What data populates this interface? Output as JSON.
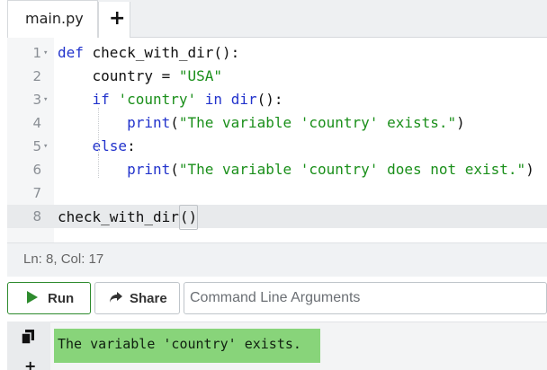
{
  "tabs": [
    {
      "label": "main.py"
    }
  ],
  "add_tab_symbol": "+",
  "editor": {
    "lines": [
      {
        "num": "1",
        "fold": true,
        "parts": [
          {
            "t": "kw",
            "v": "def"
          },
          {
            "t": "plain",
            "v": " check_with_dir():"
          }
        ]
      },
      {
        "num": "2",
        "fold": false,
        "parts": [
          {
            "t": "plain",
            "v": "    country = "
          },
          {
            "t": "str",
            "v": "\"USA\""
          }
        ]
      },
      {
        "num": "3",
        "fold": true,
        "parts": [
          {
            "t": "plain",
            "v": "    "
          },
          {
            "t": "kw",
            "v": "if"
          },
          {
            "t": "plain",
            "v": " "
          },
          {
            "t": "str",
            "v": "'country'"
          },
          {
            "t": "plain",
            "v": " "
          },
          {
            "t": "kw",
            "v": "in"
          },
          {
            "t": "plain",
            "v": " "
          },
          {
            "t": "kw",
            "v": "dir"
          },
          {
            "t": "plain",
            "v": "():"
          }
        ]
      },
      {
        "num": "4",
        "fold": false,
        "parts": [
          {
            "t": "plain",
            "v": "        "
          },
          {
            "t": "kw",
            "v": "print"
          },
          {
            "t": "plain",
            "v": "("
          },
          {
            "t": "str",
            "v": "\"The variable 'country' exists.\""
          },
          {
            "t": "plain",
            "v": ")"
          }
        ]
      },
      {
        "num": "5",
        "fold": true,
        "parts": [
          {
            "t": "plain",
            "v": "    "
          },
          {
            "t": "kw",
            "v": "else"
          },
          {
            "t": "plain",
            "v": ":"
          }
        ]
      },
      {
        "num": "6",
        "fold": false,
        "parts": [
          {
            "t": "plain",
            "v": "        "
          },
          {
            "t": "kw",
            "v": "print"
          },
          {
            "t": "plain",
            "v": "("
          },
          {
            "t": "str",
            "v": "\"The variable 'country' does not exist.\""
          },
          {
            "t": "plain",
            "v": ")"
          }
        ]
      },
      {
        "num": "7",
        "fold": false,
        "parts": []
      },
      {
        "num": "8",
        "fold": false,
        "active": true,
        "parts": [
          {
            "t": "plain",
            "v": "check_with_dir"
          },
          {
            "t": "cursorbox",
            "v": "()"
          }
        ]
      }
    ]
  },
  "status": {
    "text": "Ln: 8,  Col: 17"
  },
  "toolbar": {
    "run_label": "Run",
    "share_label": "Share"
  },
  "args": {
    "placeholder": "Command Line Arguments",
    "value": ""
  },
  "output": {
    "text": "The variable 'country' exists."
  },
  "colors": {
    "run_icon": "#2e8b2e",
    "output_bg": "#88d47a",
    "keyword": "#2233cc",
    "string": "#1a8f1a"
  },
  "icons": {
    "run": "play-icon",
    "share": "share-arrow-icon",
    "copy": "copy-icon",
    "add": "plus-icon",
    "fold": "chevron-down-icon"
  }
}
